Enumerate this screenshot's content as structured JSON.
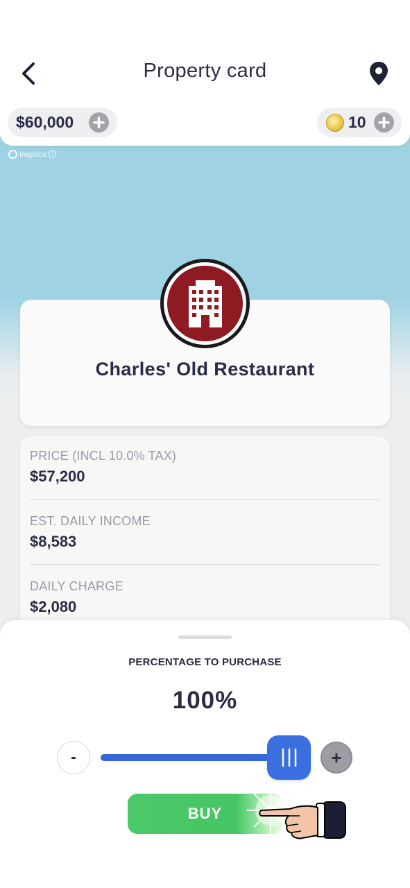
{
  "header": {
    "title": "Property card",
    "back_icon": "chevron-left-icon",
    "location_icon": "map-pin-icon"
  },
  "balances": {
    "money": "$60,000",
    "coins": "10"
  },
  "map": {
    "attribution": "mapbox"
  },
  "property": {
    "name": "Charles' Old Restaurant",
    "icon": "building-icon",
    "badge_color": "#8e1a22"
  },
  "details": [
    {
      "label": "PRICE (INCL 10.0% TAX)",
      "value": "$57,200"
    },
    {
      "label": "EST. DAILY INCOME",
      "value": "$8,583"
    },
    {
      "label": "DAILY CHARGE",
      "value": "$2,080"
    }
  ],
  "purchase": {
    "label": "PERCENTAGE TO PURCHASE",
    "percent_text": "100%",
    "percent_value": 100,
    "minus_label": "-",
    "plus_label": "+",
    "buy_label": "BUY",
    "accent_color": "#3b6fe0",
    "buy_color": "#46c564"
  }
}
